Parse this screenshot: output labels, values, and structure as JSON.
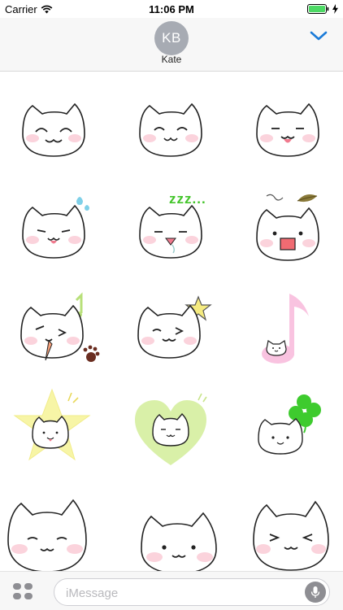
{
  "status_bar": {
    "carrier": "Carrier",
    "time": "11:06 PM",
    "icons": [
      "wifi-icon",
      "battery-icon",
      "charging-bolt-icon"
    ]
  },
  "header": {
    "avatar_initials": "KB",
    "contact_name": "Kate",
    "collapse_icon": "chevron-down-icon",
    "accent_color": "#1a7bd8"
  },
  "stickers": [
    {
      "name": "happy-squint-cat"
    },
    {
      "name": "smiling-cat"
    },
    {
      "name": "tongue-out-cat"
    },
    {
      "name": "sweating-cat"
    },
    {
      "name": "sleepy-cat",
      "caption": "zzz..."
    },
    {
      "name": "surprised-cat-with-leaf"
    },
    {
      "name": "licking-cat-with-paw"
    },
    {
      "name": "winking-cat-with-star"
    },
    {
      "name": "music-note-cat"
    },
    {
      "name": "star-cat"
    },
    {
      "name": "heart-cat"
    },
    {
      "name": "clover-cat"
    },
    {
      "name": "content-cat"
    },
    {
      "name": "dot-eyes-cat"
    },
    {
      "name": "squinting-cat"
    }
  ],
  "input_bar": {
    "placeholder": "iMessage",
    "apps_icon": "app-drawer-icon",
    "mic_icon": "microphone-icon"
  }
}
